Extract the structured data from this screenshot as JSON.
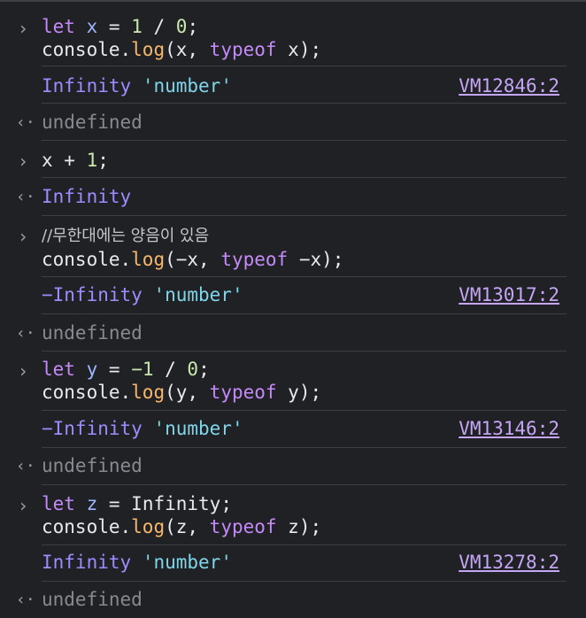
{
  "entries": [
    {
      "type": "input",
      "lines": [
        [
          {
            "t": "let",
            "c": "kw"
          },
          {
            "t": " "
          },
          {
            "t": "x",
            "c": "var"
          },
          {
            "t": " = "
          },
          {
            "t": "1",
            "c": "num"
          },
          {
            "t": " / "
          },
          {
            "t": "0",
            "c": "num"
          },
          {
            "t": ";"
          }
        ],
        [
          {
            "t": "console."
          },
          {
            "t": "log",
            "c": "fn"
          },
          {
            "t": "(x, "
          },
          {
            "t": "typeof",
            "c": "kw"
          },
          {
            "t": " x);"
          }
        ]
      ]
    },
    {
      "type": "output",
      "parts": [
        {
          "t": "Infinity",
          "c": "inf"
        },
        {
          "t": " "
        },
        {
          "t": "'number'",
          "c": "str"
        }
      ],
      "source": "VM12846:2"
    },
    {
      "type": "return",
      "parts": [
        {
          "t": "undefined",
          "c": "undef"
        }
      ]
    },
    {
      "type": "input",
      "lines": [
        [
          {
            "t": "x + "
          },
          {
            "t": "1",
            "c": "num"
          },
          {
            "t": ";"
          }
        ]
      ]
    },
    {
      "type": "return",
      "parts": [
        {
          "t": "Infinity",
          "c": "inf"
        }
      ]
    },
    {
      "type": "input",
      "lines": [
        [
          {
            "t": "//무한대에는 양음이 있음",
            "c": "cmt"
          }
        ],
        [
          {
            "t": "console."
          },
          {
            "t": "log",
            "c": "fn"
          },
          {
            "t": "(−x, "
          },
          {
            "t": "typeof",
            "c": "kw"
          },
          {
            "t": " −x);"
          }
        ]
      ]
    },
    {
      "type": "output",
      "parts": [
        {
          "t": "−Infinity",
          "c": "inf"
        },
        {
          "t": " "
        },
        {
          "t": "'number'",
          "c": "str"
        }
      ],
      "source": "VM13017:2"
    },
    {
      "type": "return",
      "parts": [
        {
          "t": "undefined",
          "c": "undef"
        }
      ]
    },
    {
      "type": "input",
      "lines": [
        [
          {
            "t": "let",
            "c": "kw"
          },
          {
            "t": " "
          },
          {
            "t": "y",
            "c": "var"
          },
          {
            "t": " = "
          },
          {
            "t": "−1",
            "c": "num"
          },
          {
            "t": " / "
          },
          {
            "t": "0",
            "c": "num"
          },
          {
            "t": ";"
          }
        ],
        [
          {
            "t": "console."
          },
          {
            "t": "log",
            "c": "fn"
          },
          {
            "t": "(y, "
          },
          {
            "t": "typeof",
            "c": "kw"
          },
          {
            "t": " y);"
          }
        ]
      ]
    },
    {
      "type": "output",
      "parts": [
        {
          "t": "−Infinity",
          "c": "inf"
        },
        {
          "t": " "
        },
        {
          "t": "'number'",
          "c": "str"
        }
      ],
      "source": "VM13146:2"
    },
    {
      "type": "return",
      "parts": [
        {
          "t": "undefined",
          "c": "undef"
        }
      ]
    },
    {
      "type": "input",
      "lines": [
        [
          {
            "t": "let",
            "c": "kw"
          },
          {
            "t": " "
          },
          {
            "t": "z",
            "c": "var"
          },
          {
            "t": " = Infinity;"
          }
        ],
        [
          {
            "t": "console."
          },
          {
            "t": "log",
            "c": "fn"
          },
          {
            "t": "(z, "
          },
          {
            "t": "typeof",
            "c": "kw"
          },
          {
            "t": " z);"
          }
        ]
      ]
    },
    {
      "type": "output",
      "parts": [
        {
          "t": "Infinity",
          "c": "inf"
        },
        {
          "t": " "
        },
        {
          "t": "'number'",
          "c": "str"
        }
      ],
      "source": "VM13278:2"
    },
    {
      "type": "return",
      "parts": [
        {
          "t": "undefined",
          "c": "undef"
        }
      ]
    }
  ],
  "icons": {
    "prompt": "chevron-right-icon",
    "return": "return-arrow-icon"
  },
  "prompt_glyph": "›",
  "return_glyph": "‹·",
  "colors": {
    "background": "#202124",
    "keyword": "#c58af9",
    "variable": "#9eb6ff",
    "number": "#c8e8b0",
    "function": "#f8b86a",
    "string": "#7fd6ea",
    "infinity": "#9d8cff",
    "undefined": "#868b91",
    "link": "#c5a5f5"
  }
}
